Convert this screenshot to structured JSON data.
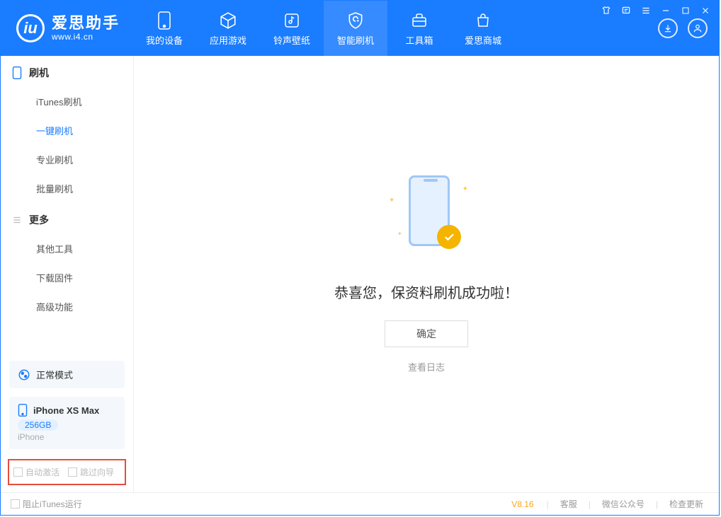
{
  "brand": {
    "name": "爱思助手",
    "url": "www.i4.cn"
  },
  "nav": {
    "device": "我的设备",
    "apps": "应用游戏",
    "ringtone": "铃声壁纸",
    "flash": "智能刷机",
    "toolbox": "工具箱",
    "store": "爱思商城"
  },
  "sidebar": {
    "group_flash": "刷机",
    "items_flash": {
      "itunes": "iTunes刷机",
      "oneclick": "一键刷机",
      "pro": "专业刷机",
      "batch": "批量刷机"
    },
    "group_more": "更多",
    "items_more": {
      "tools": "其他工具",
      "firmware": "下载固件",
      "advanced": "高级功能"
    }
  },
  "device": {
    "mode": "正常模式",
    "name": "iPhone XS Max",
    "capacity": "256GB",
    "type": "iPhone"
  },
  "bottom_options": {
    "auto_activate": "自动激活",
    "skip_guide": "跳过向导"
  },
  "main": {
    "success_message": "恭喜您，保资料刷机成功啦！",
    "confirm": "确定",
    "view_log": "查看日志"
  },
  "footer": {
    "block_itunes": "阻止iTunes运行",
    "version": "V8.16",
    "support": "客服",
    "wechat": "微信公众号",
    "update": "检查更新"
  }
}
